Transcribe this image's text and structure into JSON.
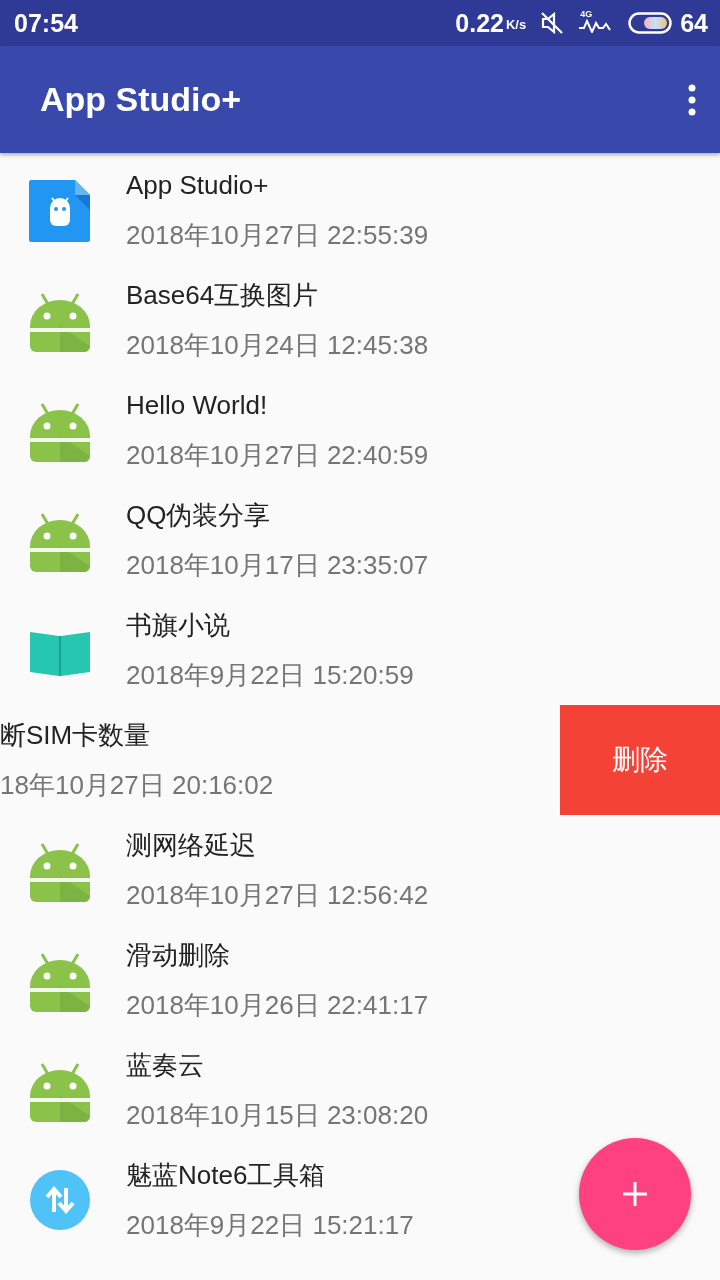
{
  "status_bar": {
    "time": "07:54",
    "speed": "0.22",
    "speed_unit": "K/s",
    "network": "4G",
    "battery": "64"
  },
  "app_bar": {
    "title": "App Studio+"
  },
  "items": [
    {
      "kind": "normal",
      "title": "App Studio+",
      "date": "2018年10月27日 22:55:39"
    },
    {
      "kind": "normal",
      "title": "Base64互换图片",
      "date": "2018年10月24日 12:45:38"
    },
    {
      "kind": "normal",
      "title": "Hello World!",
      "date": "2018年10月27日 22:40:59"
    },
    {
      "kind": "normal",
      "title": "QQ伪装分享",
      "date": "2018年10月17日 23:35:07"
    },
    {
      "kind": "normal",
      "title": "书旗小说",
      "date": "2018年9月22日 15:20:59"
    },
    {
      "kind": "swiped",
      "title": "断SIM卡数量",
      "date": "18年10月27日 20:16:02",
      "action": "删除"
    },
    {
      "kind": "normal",
      "title": "测网络延迟",
      "date": "2018年10月27日 12:56:42"
    },
    {
      "kind": "normal",
      "title": "滑动删除",
      "date": "2018年10月26日 22:41:17"
    },
    {
      "kind": "normal",
      "title": "蓝奏云",
      "date": "2018年10月15日 23:08:20"
    },
    {
      "kind": "normal",
      "title": "魅蓝Note6工具箱",
      "date": "2018年9月22日 15:21:17"
    }
  ],
  "fab": {
    "kind": "add"
  }
}
